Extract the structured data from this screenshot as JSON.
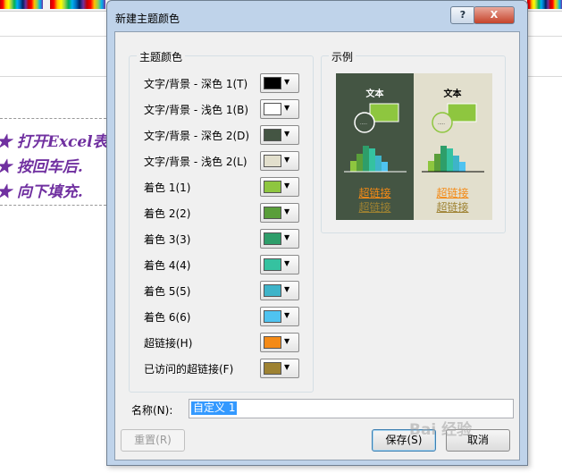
{
  "background": {
    "lines": [
      "★ 打开Excel表",
      "★ 按回车后.",
      "★ 向下填充."
    ]
  },
  "dialog": {
    "title": "新建主题颜色",
    "help_label": "?",
    "close_label": "X",
    "theme_group_label": "主题颜色",
    "sample_group_label": "示例",
    "rows": [
      {
        "label": "文字/背景 - 深色 1(T)",
        "color": "#000000"
      },
      {
        "label": "文字/背景 - 浅色 1(B)",
        "color": "#ffffff"
      },
      {
        "label": "文字/背景 - 深色 2(D)",
        "color": "#445543"
      },
      {
        "label": "文字/背景 - 浅色 2(L)",
        "color": "#e2dfcd"
      },
      {
        "label": "着色 1(1)",
        "color": "#8ec63f"
      },
      {
        "label": "着色 2(2)",
        "color": "#5a9e3a"
      },
      {
        "label": "着色 3(3)",
        "color": "#2e9e6a"
      },
      {
        "label": "着色 4(4)",
        "color": "#35c2a0"
      },
      {
        "label": "着色 5(5)",
        "color": "#3eb4c9"
      },
      {
        "label": "着色 6(6)",
        "color": "#4fc3f0"
      },
      {
        "label": "超链接(H)",
        "color": "#f48a16"
      },
      {
        "label": "已访问的超链接(F)",
        "color": "#9e8232"
      }
    ],
    "sample": {
      "text_label": "文本",
      "hyperlink_label": "超链接",
      "visited_label": "超链接",
      "bubble_text": "....."
    },
    "name_label": "名称(N):",
    "name_value": "自定义 1",
    "reset_label": "重置(R)",
    "save_label": "保存(S)",
    "cancel_label": "取消"
  },
  "watermark": "Bai 经验"
}
